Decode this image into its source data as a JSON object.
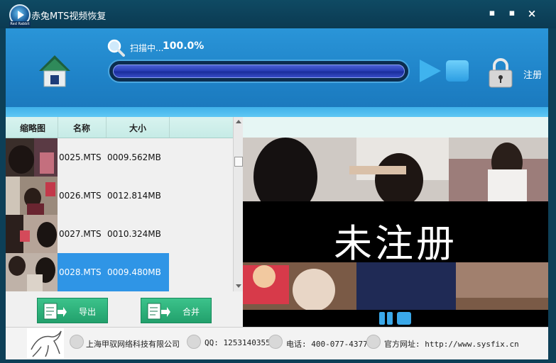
{
  "window": {
    "title": "赤兔MTS视频恢复",
    "icon_tag": "Red Rabbit",
    "controls": {
      "minimize": "▪",
      "maximize": "▪",
      "close": "×"
    }
  },
  "toolbar": {
    "scan_label": "扫描中...",
    "scan_percent": "100.0%",
    "progress_fraction": 1.0,
    "register_label": "注册"
  },
  "file_list": {
    "columns": [
      "缩略图",
      "名称",
      "大小"
    ],
    "rows": [
      {
        "name": "0025.MTS",
        "size": "0009.562MB",
        "selected": false
      },
      {
        "name": "0026.MTS",
        "size": "0012.814MB",
        "selected": false
      },
      {
        "name": "0027.MTS",
        "size": "0010.324MB",
        "selected": false
      },
      {
        "name": "0028.MTS",
        "size": "0009.480MB",
        "selected": true
      }
    ]
  },
  "actions": {
    "export_label": "导出",
    "merge_label": "合并"
  },
  "preview": {
    "watermark": "未注册"
  },
  "footer": {
    "company": "上海甲驭网络科技有限公司",
    "qq": "QQ: 1253140355",
    "phone": "电话: 400-077-4377",
    "website": "官方网址: http://www.sysfix.cn"
  },
  "colors": {
    "accent": "#2f95e6",
    "toolbar": "#2a95d8",
    "button_green": "#2eb07a"
  }
}
